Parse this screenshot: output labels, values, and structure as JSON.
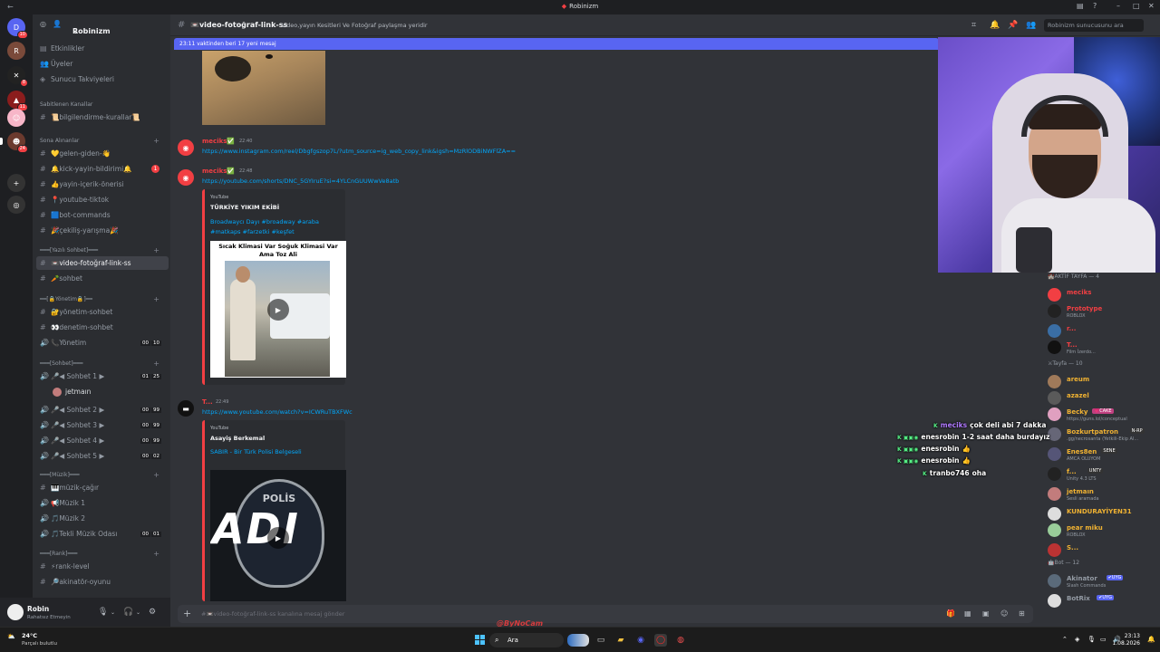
{
  "window": {
    "title": "Robinizm",
    "back": "←",
    "icons": [
      "inbox-icon",
      "help-icon",
      "minimize",
      "maximize",
      "close"
    ]
  },
  "guilds": [
    {
      "badge": "10",
      "color": "#5865f2",
      "glyph": "D"
    },
    {
      "badge": "",
      "color": "#7a4a3a",
      "glyph": "R"
    },
    {
      "badge": "8",
      "color": "#222",
      "glyph": "✕"
    },
    {
      "badge": "11",
      "color": "#8b1d1d",
      "glyph": "▲"
    },
    {
      "badge": "",
      "color": "#f7b6c8",
      "glyph": "☺"
    },
    {
      "badge": "24",
      "color": "#6b3a2e",
      "glyph": "☻"
    },
    {
      "badge": "",
      "color": "#333",
      "glyph": "+"
    },
    {
      "badge": "",
      "color": "#333",
      "glyph": "◎"
    }
  ],
  "server": {
    "name": "Robinizm",
    "chevron": "⌄"
  },
  "channels": {
    "top": [
      "Etkinlikler",
      "Üyeler",
      "Sunucu Takviyeleri"
    ],
    "pinned_label": "Sabitlenen Kanallar",
    "pinned": "📜bilgilendirme-kurallar📜",
    "recent_label": "Sona Alınanlar",
    "recent": [
      {
        "name": "💛gelen-giden-👋",
        "badge": ""
      },
      {
        "name": "🔔kick-yayin-bildirimi🔔",
        "badge": "1"
      },
      {
        "name": "👍yayin-içerik-önerisi",
        "badge": ""
      },
      {
        "name": "📍youtube-tiktok",
        "badge": ""
      },
      {
        "name": "🟦bot-commands",
        "badge": ""
      },
      {
        "name": "🎉çekiliş-yarışma🎉",
        "badge": ""
      }
    ],
    "text_cat": "━━━[Yazılı Sohbet]━━━",
    "text": [
      "📼video-fotoğraf-link-ss",
      "🥕sohbet"
    ],
    "mgmt_cat": "━━[🔒Yönetim🔒]━━",
    "mgmt": [
      {
        "name": "🔐yönetim-sohbet",
        "count": "",
        "cap": ""
      },
      {
        "name": "👀denetim-sohbet",
        "count": "",
        "cap": ""
      },
      {
        "name": "📞Yönetim",
        "count": "00",
        "cap": "10"
      }
    ],
    "chat_cat": "━━━[Sohbet]━━━",
    "voice": [
      {
        "name": "🎤◀ Sohbet 1 ▶",
        "count": "01",
        "cap": "25"
      },
      {
        "name": "🎤◀ Sohbet 2 ▶",
        "count": "00",
        "cap": "99"
      },
      {
        "name": "🎤◀ Sohbet 3 ▶",
        "count": "00",
        "cap": "99"
      },
      {
        "name": "🎤◀ Sohbet 4 ▶",
        "count": "00",
        "cap": "99"
      },
      {
        "name": "🎤◀ Sohbet 5 ▶",
        "count": "00",
        "cap": "02"
      }
    ],
    "voice_user": "jetmaın",
    "music_cat": "━━━[Müzik]━━━",
    "music_text": "🎹müzik-çağır",
    "music": [
      {
        "name": "📢Müzik 1",
        "count": "",
        "cap": ""
      },
      {
        "name": "🎵Müzik 2",
        "count": "",
        "cap": ""
      },
      {
        "name": "🎵Tekli Müzik Odası",
        "count": "00",
        "cap": "01"
      }
    ],
    "rank_cat": "━━━[Rank]━━━",
    "rank": [
      "⚡rank-level",
      "🔎akinatör-oyunu"
    ]
  },
  "user": {
    "name": "Robin",
    "status": "Rahatsız Etmeyin"
  },
  "channel": {
    "name": "📼video-fotoğraf-link-ss",
    "topic": "Video,yayın Kesitleri Ve Fotoğraf paylaşma yeridir",
    "search_placeholder": "Robinizm sunucusunu ara"
  },
  "new_messages": "23:11 vaktinden beri 17 yeni mesaj",
  "messages": [
    {
      "user": "meciks",
      "time": "22:40",
      "link": "https://www.instagram.com/reel/Dbgfgszop7L/?utm_source=ig_web_copy_link&igsh=MzRlODBiNWFlZA=="
    },
    {
      "user": "meciks",
      "time": "22:48",
      "link": "https://youtube.com/shorts/DNC_5GYIruE?si=4YLCnGUUWwVe8atb",
      "embed": {
        "provider": "YouTube",
        "title": "TÜRKİYE YIKIM EKİBİ",
        "desc": "Broadwaycı Dayı  #broadway #araba #matkaps #farzetki #keşfet",
        "caption": "Sıcak Klimasi Var Soğuk Klimasi Var Ama Toz Ali"
      }
    },
    {
      "user": "T...",
      "time": "22:49",
      "link": "https://www.youtube.com/watch?v=ICWRuTBXFWc",
      "embed": {
        "provider": "YouTube",
        "title": "Asayiş Berkemal",
        "desc": "SABIR - Bir Türk Polisi Belgeseli",
        "thumb_big": "ADI",
        "thumb_badge": "POLİS"
      }
    }
  ],
  "composer": {
    "placeholder": "#📼video-fotoğraf-link-ss kanalına mesaj gönder"
  },
  "members": {
    "active_header": "🏰AKTİF TAYFA — 4",
    "active": [
      {
        "name": "meciks",
        "sub": "",
        "color": "#f23f43",
        "avc": "#f23f43",
        "tag": ""
      },
      {
        "name": "Prototype",
        "sub": "ROBLOX",
        "color": "#f23f43",
        "avc": "#222",
        "tag": ""
      },
      {
        "name": "r...",
        "sub": "",
        "color": "#f23f43",
        "avc": "#3a6ea5",
        "tag": ""
      },
      {
        "name": "T...",
        "sub": "Film İzerdo...",
        "color": "#f23f43",
        "avc": "#111",
        "tag": ""
      }
    ],
    "tayfa_header": "⚔Tayfa — 10",
    "tayfa": [
      {
        "name": "areum",
        "sub": "",
        "color": "#f0b232",
        "avc": "#a07a5a",
        "tag": ""
      },
      {
        "name": "azazel",
        "sub": "",
        "color": "#f0b232",
        "avc": "#5a5a5a",
        "tag": ""
      },
      {
        "name": "Becky",
        "sub": "https://guns.lol/conceptual",
        "color": "#f0b232",
        "avc": "#e0a0c0",
        "tag": "💗CAKE",
        "tagc": "#c04080"
      },
      {
        "name": "Bozkurtpatron",
        "sub": ".gg/necrosanta (Yetkili-Ekip Al...",
        "color": "#f0b232",
        "avc": "#667",
        "tag": "N-RP",
        "tagc": "#333"
      },
      {
        "name": "Enes8en",
        "sub": "AMCA OLUYOM",
        "color": "#f0b232",
        "avc": "#557",
        "tag": "SENE",
        "tagc": "#333"
      },
      {
        "name": "f...",
        "sub": "Unity 4.3 LTS",
        "color": "#f0b232",
        "avc": "#222",
        "tag": "UNTY",
        "tagc": "#333"
      },
      {
        "name": "jetmaın",
        "sub": "Sesli aramada",
        "color": "#f0b232",
        "avc": "#c27c7c",
        "tag": ""
      },
      {
        "name": "KUNDURAYİYEN31",
        "sub": "",
        "color": "#f0b232",
        "avc": "#ddd",
        "tag": ""
      },
      {
        "name": "pear miku",
        "sub": "ROBLOX",
        "color": "#f0b232",
        "avc": "#9c9",
        "tag": ""
      },
      {
        "name": "S...",
        "sub": "",
        "color": "#f0b232",
        "avc": "#b33",
        "tag": ""
      }
    ],
    "bot_header": "🤖Bot — 12",
    "bots": [
      {
        "name": "Akinator",
        "sub": "Slash Commands",
        "color": "#949ba4",
        "avc": "#5a6a7a",
        "tag": "✔UYG",
        "tagc": "#5865f2"
      },
      {
        "name": "BotRix",
        "sub": "",
        "color": "#949ba4",
        "avc": "#ddd",
        "tag": "✔UYG",
        "tagc": "#5865f2"
      }
    ]
  },
  "chat_overlay": [
    {
      "user": "meciks",
      "text": "çok deli abi 7 dakka",
      "ucolor": "#b07aff"
    },
    {
      "user": "enesrobin",
      "text": "1-2 saat daha burdayız",
      "ucolor": "#ffffff"
    },
    {
      "user": "enesrobin",
      "text": "👍",
      "ucolor": "#ffffff"
    },
    {
      "user": "enesrobin",
      "text": "👍",
      "ucolor": "#ffffff"
    },
    {
      "user": "tranbo746",
      "text": "oha",
      "ucolor": "#ffffff"
    }
  ],
  "watermark": "@ByNoCam",
  "taskbar": {
    "temp": "24°C",
    "weather": "Parçalı bulutlu",
    "search": "Ara",
    "time": "23:13",
    "date": "1.08.2026"
  }
}
